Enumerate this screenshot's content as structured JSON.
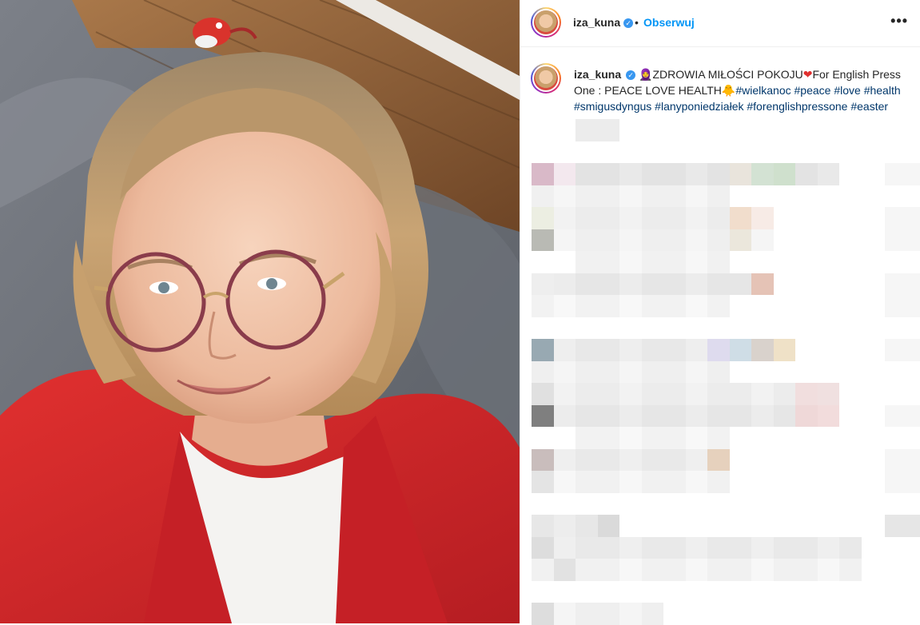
{
  "post": {
    "username": "iza_kuna",
    "verified_mark": "✓",
    "separator": "•",
    "follow_label": "Obserwuj",
    "more_label": "•••"
  },
  "caption": {
    "username": "iza_kuna",
    "verified_mark": "✓",
    "emoji_start": "🧕",
    "text_main": "ZDROWIA MIŁOŚCI POKOJU",
    "emoji_heart": "❤",
    "text_english": "For English Press One : PEACE LOVE HEALTH",
    "emoji_chick": "🐥",
    "hashtags": [
      "#wielkanoc",
      "#peace",
      "#love",
      "#health",
      "#smigusdyngus",
      "#lanyponiedziałek",
      "#forenglishpressone",
      "#easter"
    ]
  },
  "colors": {
    "follow": "#0095f6",
    "hashtag": "#00376b",
    "verified": "#3897f0",
    "sweater": "#d8262c"
  },
  "icons": [
    "verified-badge-icon",
    "more-options-icon"
  ]
}
